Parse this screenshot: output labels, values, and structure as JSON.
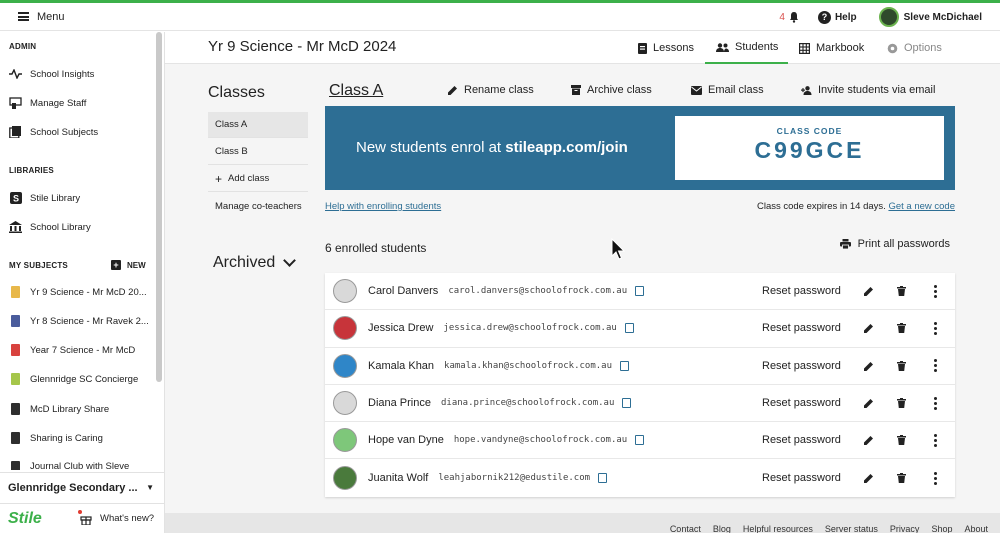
{
  "topbar": {
    "menu_label": "Menu",
    "notif_count": "4",
    "help_label": "Help",
    "user_name": "Sleve McDichael"
  },
  "sidebar": {
    "admin_title": "ADMIN",
    "admin_items": [
      {
        "label": "School Insights",
        "icon": "pulse-icon"
      },
      {
        "label": "Manage Staff",
        "icon": "staff-icon"
      },
      {
        "label": "School Subjects",
        "icon": "books-icon"
      }
    ],
    "libraries_title": "LIBRARIES",
    "library_items": [
      {
        "label": "Stile Library",
        "icon": "stile-s-icon"
      },
      {
        "label": "School Library",
        "icon": "library-icon"
      }
    ],
    "subjects_title": "MY SUBJECTS",
    "new_label": "NEW",
    "subject_items": [
      {
        "label": "Yr 9 Science - Mr McD 20...",
        "color": "#e8b84a"
      },
      {
        "label": "Yr 8 Science - Mr Ravek 2...",
        "color": "#4a5c9c"
      },
      {
        "label": "Year 7 Science - Mr McD",
        "color": "#d8423e"
      },
      {
        "label": "Glennridge SC Concierge",
        "color": "#a5c64a"
      },
      {
        "label": "McD Library Share",
        "color": "#2e2e2e"
      },
      {
        "label": "Sharing is Caring",
        "color": "#2e2e2e"
      },
      {
        "label": "Journal Club with Sleve",
        "color": "#2e2e2e"
      }
    ],
    "school_name": "Glennridge Secondary ...",
    "logo": "Stile",
    "whats_new": "What's new?"
  },
  "header": {
    "course_title": "Yr 9 Science - Mr McD 2024",
    "tabs": {
      "lessons": "Lessons",
      "students": "Students",
      "markbook": "Markbook",
      "options": "Options"
    }
  },
  "classes": {
    "title": "Classes",
    "items": [
      "Class A",
      "Class B"
    ],
    "add_class": "Add class",
    "manage": "Manage co-teachers",
    "archived": "Archived"
  },
  "class_panel": {
    "heading": "Class A",
    "rename": "Rename class",
    "archive": "Archive class",
    "email": "Email class",
    "invite": "Invite students via email",
    "banner_prefix": "New students enrol at ",
    "banner_url": "stileapp.com/join",
    "code_label": "CLASS CODE",
    "code_value": "C99GCE",
    "help_link": "Help with enrolling students",
    "expires_text": "Class code expires in 14 days.",
    "new_code": "Get a new code",
    "enrolled": "6 enrolled students",
    "print_all": "Print all passwords",
    "reset_label": "Reset password",
    "accent": "#2d6e94"
  },
  "students": [
    {
      "name": "Carol Danvers",
      "email": "carol.danvers@schoolofrock.com.au",
      "avatar_color": "#d9d9d9"
    },
    {
      "name": "Jessica Drew",
      "email": "jessica.drew@schoolofrock.com.au",
      "avatar_color": "#c7343a"
    },
    {
      "name": "Kamala Khan",
      "email": "kamala.khan@schoolofrock.com.au",
      "avatar_color": "#2f86c8"
    },
    {
      "name": "Diana Prince",
      "email": "diana.prince@schoolofrock.com.au",
      "avatar_color": "#d9d9d9"
    },
    {
      "name": "Hope van Dyne",
      "email": "hope.vandyne@schoolofrock.com.au",
      "avatar_color": "#7ec77a"
    },
    {
      "name": "Juanita Wolf",
      "email": "leahjabornik212@edustile.com",
      "avatar_color": "#4a7a3c"
    }
  ],
  "footer": {
    "links": [
      "Contact",
      "Blog",
      "Helpful resources",
      "Server status",
      "Privacy",
      "Shop",
      "About"
    ]
  }
}
